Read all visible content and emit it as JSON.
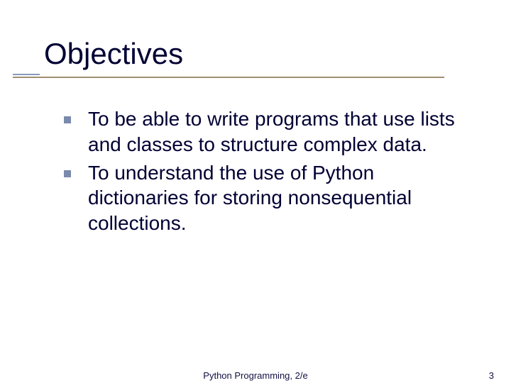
{
  "title": "Objectives",
  "bullets": [
    "To be able to write programs that use lists and classes to structure complex data.",
    "To understand the use of Python dictionaries for storing nonsequential collections."
  ],
  "footer": {
    "center": "Python Programming, 2/e",
    "page": "3"
  }
}
